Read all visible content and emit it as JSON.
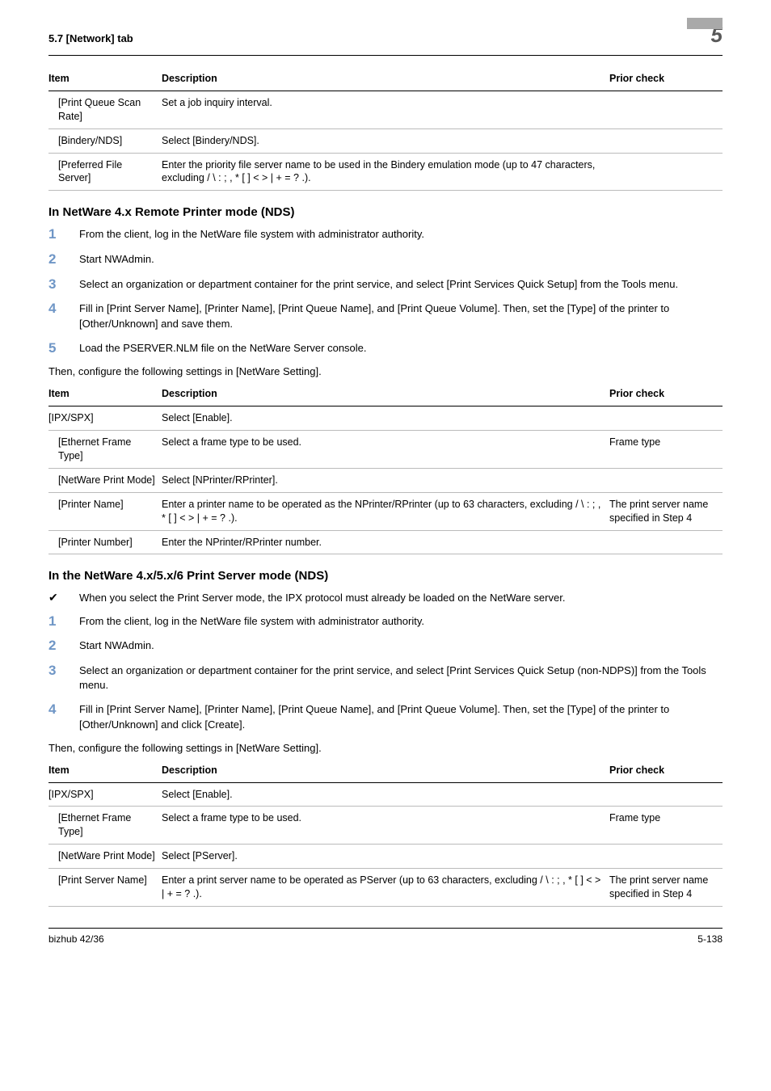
{
  "header": {
    "left": "5.7      [Network] tab",
    "page_marker": "5"
  },
  "table1": {
    "headers": [
      "Item",
      "Description",
      "Prior check"
    ],
    "rows": [
      {
        "item": "[Print Queue Scan Rate]",
        "desc": "Set a job inquiry interval.",
        "prior": "",
        "indent": true
      },
      {
        "item": "[Bindery/NDS]",
        "desc": "Select [Bindery/NDS].",
        "prior": "",
        "indent": true
      },
      {
        "item": "[Preferred File Server]",
        "desc": "Enter the priority file server name to be used in the Bindery emulation mode (up to 47 characters, excluding / \\ : ; , * [ ] < > | + = ? .).",
        "prior": "",
        "indent": true
      }
    ]
  },
  "section_a": {
    "title": "In NetWare 4.x Remote Printer mode (NDS)",
    "steps": [
      "From the client, log in the NetWare file system with administrator authority.",
      "Start NWAdmin.",
      "Select an organization or department container for the print service, and select [Print Services Quick Setup] from the Tools menu.",
      "Fill in [Print Server Name], [Printer Name], [Print Queue Name], and [Print Queue Volume]. Then, set the [Type] of the printer to [Other/Unknown] and save them.",
      "Load the PSERVER.NLM file on the NetWare Server console."
    ],
    "after": "Then, configure the following settings in [NetWare Setting]."
  },
  "table2": {
    "headers": [
      "Item",
      "Description",
      "Prior check"
    ],
    "rows": [
      {
        "item": "[IPX/SPX]",
        "desc": "Select [Enable].",
        "prior": ""
      },
      {
        "item": "[Ethernet Frame Type]",
        "desc": "Select a frame type to be used.",
        "prior": "Frame type",
        "indent": true
      },
      {
        "item": "[NetWare Print Mode]",
        "desc": "Select [NPrinter/RPrinter].",
        "prior": "",
        "indent": true
      },
      {
        "item": "[Printer Name]",
        "desc": "Enter a printer name to be operated as the NPrinter/RPrinter (up to 63 characters, excluding / \\ : ; , * [ ] < > | + = ? .).",
        "prior": "The print server name specified in Step 4",
        "indent": true
      },
      {
        "item": "[Printer Number]",
        "desc": "Enter the NPrinter/RPrinter number.",
        "prior": "",
        "indent": true
      }
    ]
  },
  "section_b": {
    "title": "In the NetWare 4.x/5.x/6 Print Server mode (NDS)",
    "check": "When you select the Print Server mode, the IPX protocol must already be loaded on the NetWare server.",
    "steps": [
      "From the client, log in the NetWare file system with administrator authority.",
      "Start NWAdmin.",
      "Select an organization or department container for the print service, and select [Print Services Quick Setup (non-NDPS)] from the Tools menu.",
      "Fill in [Print Server Name], [Printer Name], [Print Queue Name], and [Print Queue Volume]. Then, set the [Type] of the printer to [Other/Unknown] and click [Create]."
    ],
    "after": "Then, configure the following settings in [NetWare Setting]."
  },
  "table3": {
    "headers": [
      "Item",
      "Description",
      "Prior check"
    ],
    "rows": [
      {
        "item": "[IPX/SPX]",
        "desc": "Select [Enable].",
        "prior": ""
      },
      {
        "item": "[Ethernet Frame Type]",
        "desc": "Select a frame type to be used.",
        "prior": "Frame type",
        "indent": true
      },
      {
        "item": "[NetWare Print Mode]",
        "desc": "Select [PServer].",
        "prior": "",
        "indent": true
      },
      {
        "item": "[Print Server Name]",
        "desc": "Enter a print server name to be operated as PServer (up to 63 characters, excluding / \\ : ; , * [ ] < > | + = ? .).",
        "prior": "The print server name specified in Step 4",
        "indent": true
      }
    ]
  },
  "footer": {
    "left": "bizhub 42/36",
    "right": "5-138"
  }
}
